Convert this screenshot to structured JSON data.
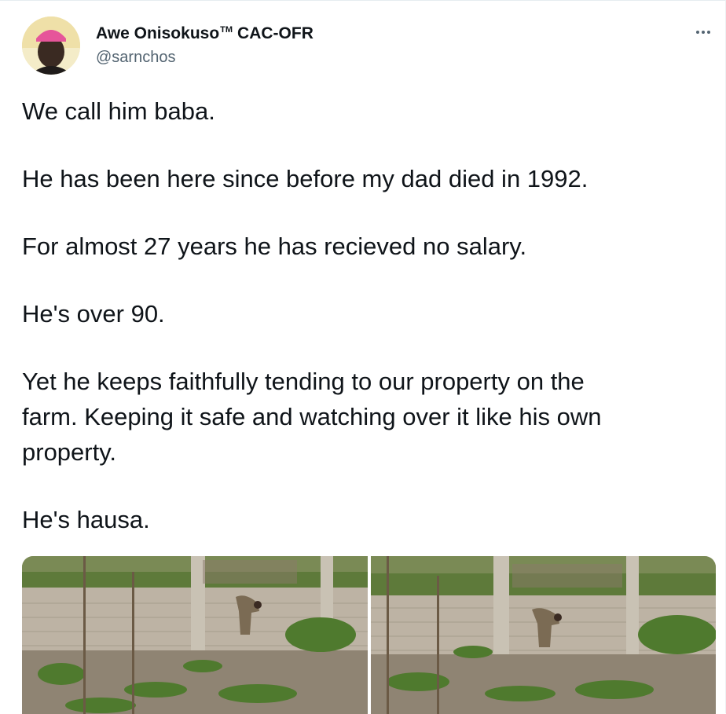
{
  "author": {
    "display_name": "Awe Onisokuso",
    "tm": "TM",
    "suffix": "CAC-OFR",
    "handle": "@sarnchos",
    "avatar_icon": "profile-photo-man-pink-cap"
  },
  "menu": {
    "icon": "more-horizontal-icon"
  },
  "tweet": {
    "lines": [
      "We call him baba.",
      "He has been here since before my dad died in 1992.",
      "For almost 27 years he has recieved no salary.",
      "He's over 90.",
      "Yet he keeps faithfully tending to our property on the",
      "farm. Keeping it safe and watching over it like his own",
      "property.",
      "He's hausa."
    ]
  },
  "media": {
    "photos": [
      {
        "icon": "photo-farm-man-bending-by-wall-1"
      },
      {
        "icon": "photo-farm-man-bending-by-wall-2"
      }
    ]
  },
  "colors": {
    "text": "#0f1419",
    "secondary": "#536471",
    "border": "#e6ecf0"
  }
}
